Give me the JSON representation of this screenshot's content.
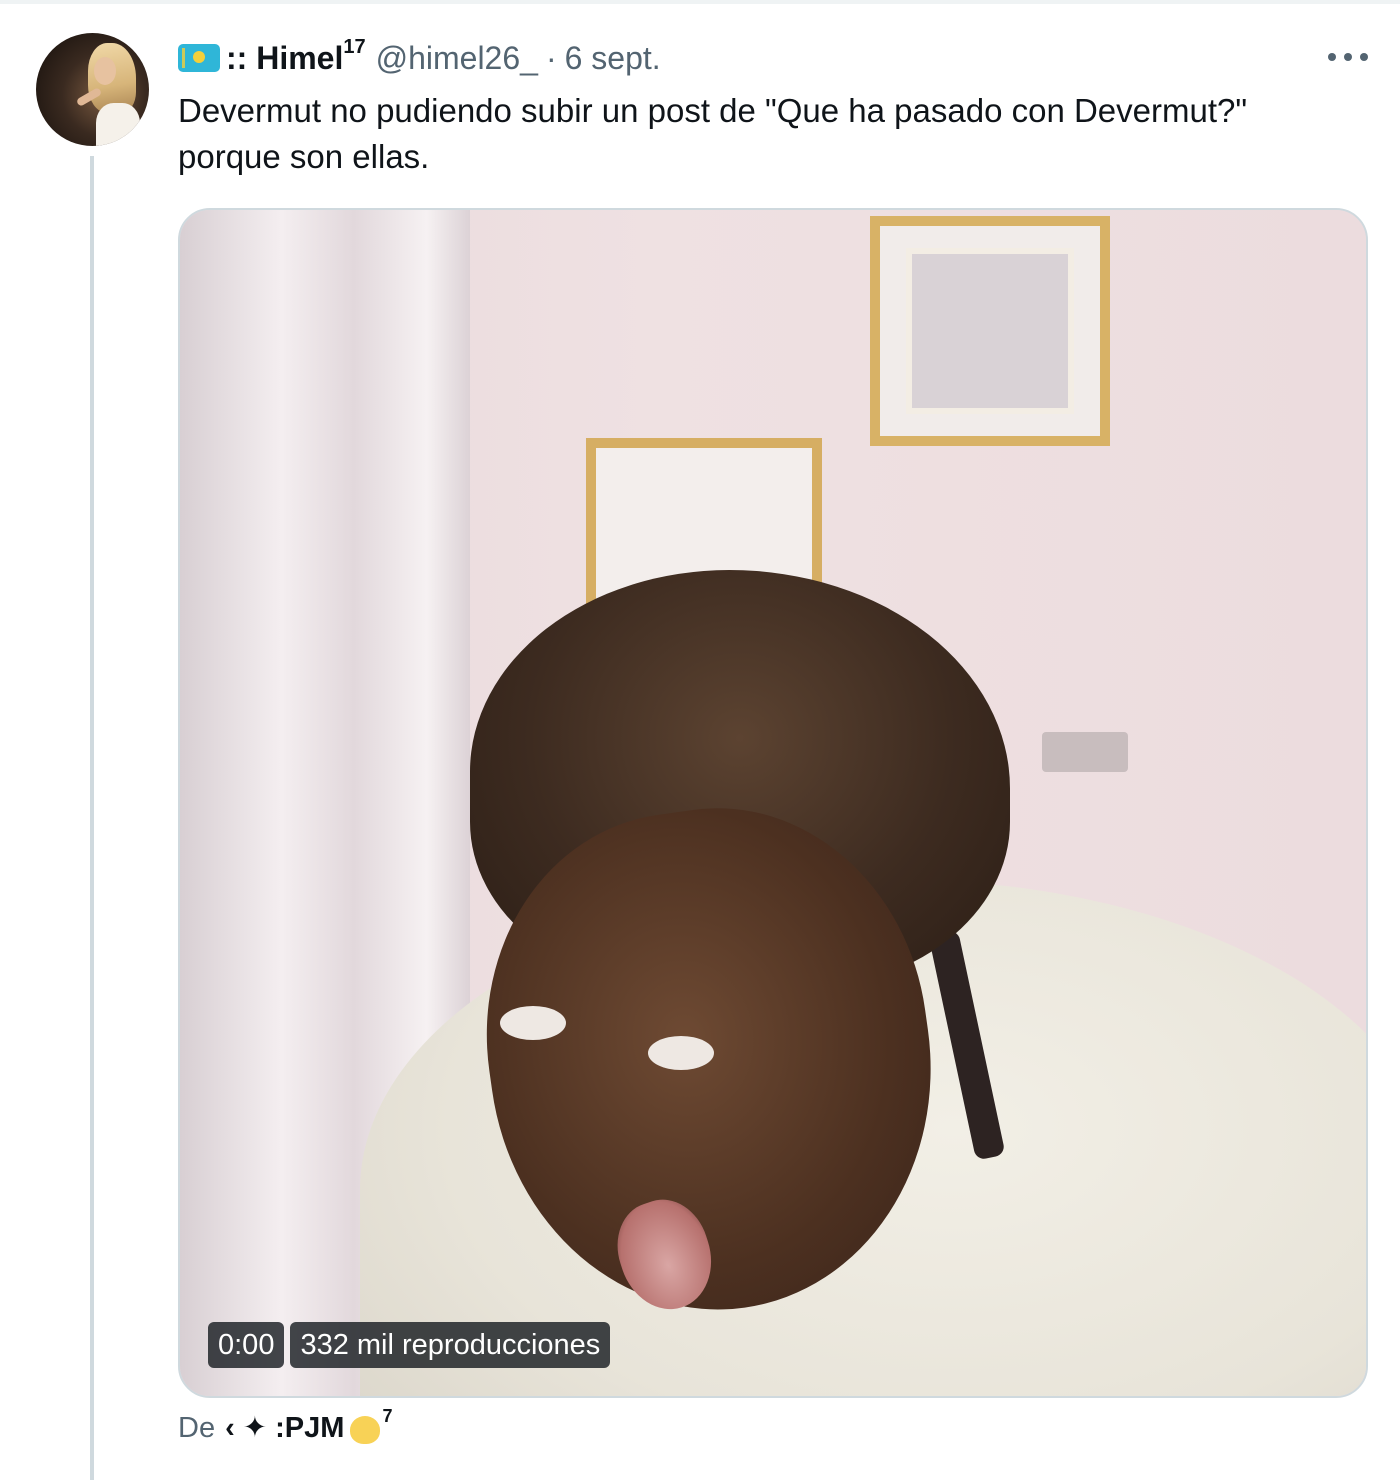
{
  "tweet": {
    "display_name": ":: Himel",
    "name_superscript": "17",
    "handle": "@himel26_",
    "separator": "·",
    "date": "6 sept.",
    "text": "Devermut no pudiendo subir un post de \"Que ha pasado con Devermut?\" porque son ellas.",
    "video": {
      "time": "0:00",
      "views": "332 mil reproducciones"
    },
    "source": {
      "prefix": "De",
      "name": "‹ ✦ :PJM",
      "superscript": "7"
    }
  },
  "icons": [
    "kazakhstan-flag-icon",
    "more-options-icon",
    "chick-emoji-icon"
  ],
  "colors": {
    "text_primary": "#0f1419",
    "text_secondary": "#536471",
    "thread_line": "#cfd9de",
    "flag_blue": "#2fb6d8",
    "flag_gold": "#f4d03a"
  }
}
